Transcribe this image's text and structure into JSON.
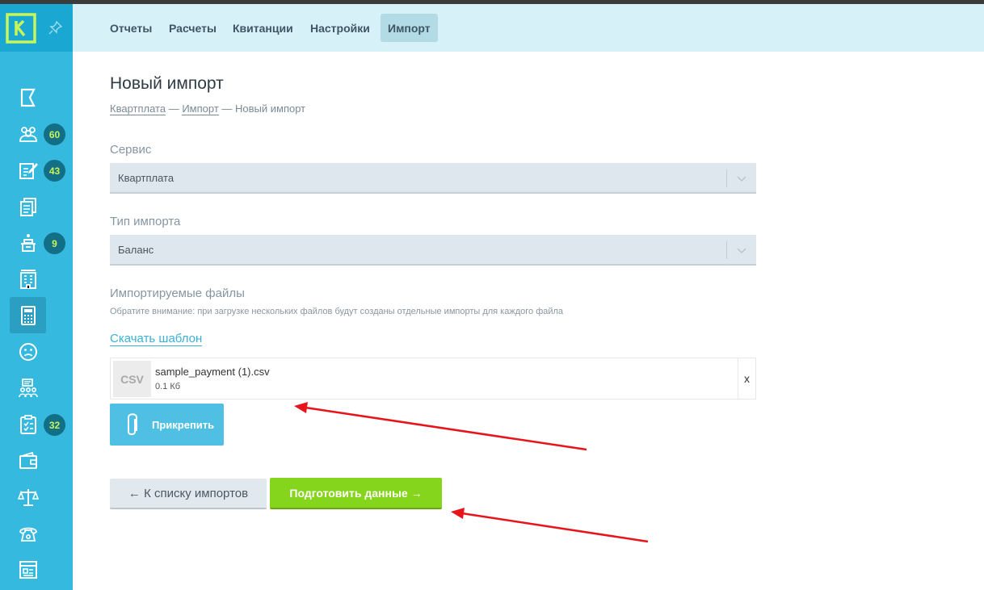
{
  "app": {
    "logo_letter": "K"
  },
  "sidebar": {
    "items": [
      {
        "icon": "flag-icon",
        "badge": null
      },
      {
        "icon": "residents-icon",
        "badge": "60"
      },
      {
        "icon": "edit-document-icon",
        "badge": "43"
      },
      {
        "icon": "documents-icon",
        "badge": null
      },
      {
        "icon": "meter-icon",
        "badge": "9"
      },
      {
        "icon": "building-icon",
        "badge": null
      },
      {
        "icon": "calculator-icon",
        "badge": null,
        "active": true
      },
      {
        "icon": "sad-face-icon",
        "badge": null
      },
      {
        "icon": "meeting-icon",
        "badge": null
      },
      {
        "icon": "checklist-icon",
        "badge": "32"
      },
      {
        "icon": "wallet-icon",
        "badge": null
      },
      {
        "icon": "scales-icon",
        "badge": null
      },
      {
        "icon": "phone-icon",
        "badge": null
      },
      {
        "icon": "browser-window-icon",
        "badge": null
      }
    ]
  },
  "tabs": [
    {
      "label": "Отчеты"
    },
    {
      "label": "Расчеты"
    },
    {
      "label": "Квитанции"
    },
    {
      "label": "Настройки"
    },
    {
      "label": "Импорт",
      "active": true
    }
  ],
  "page": {
    "title": "Новый импорт",
    "breadcrumb": {
      "first": "Квартплата",
      "second": "Импорт",
      "current": "Новый импорт",
      "separator": "—"
    }
  },
  "form": {
    "service_label": "Сервис",
    "service_value": "Квартплата",
    "type_label": "Тип импорта",
    "type_value": "Баланс",
    "files_label": "Импортируемые файлы",
    "files_note": "Обратите внимание: при загрузке нескольких файлов будут созданы отдельные импорты для каждого файла",
    "download_template": "Скачать шаблон",
    "file": {
      "type_tag": "CSV",
      "name": "sample_payment (1).csv",
      "size": "0.1 Кб",
      "remove": "x"
    },
    "attach_button": "Прикрепить",
    "back_button": "← К списку импортов",
    "next_button": "Подготовить данные →"
  },
  "colors": {
    "sidebar": "#35b9de",
    "topbar": "#d6f1f7",
    "badge_bg": "#126f86",
    "badge_text": "#c8f55a",
    "primary": "#86d51d",
    "attach": "#4fc0e4",
    "annotation": "#e8141b"
  }
}
